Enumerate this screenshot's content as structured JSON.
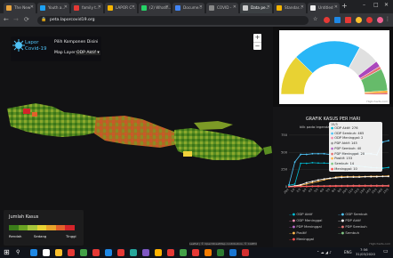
{
  "tabs": [
    {
      "label": "The New",
      "color": "#e8a33d"
    },
    {
      "label": "Youth a...",
      "color": "#1da1f2"
    },
    {
      "label": "family t...",
      "color": "#e53935"
    },
    {
      "label": "LAPOR C...",
      "color": "#f4b400"
    },
    {
      "label": "(2) Whats...",
      "color": "#25d366"
    },
    {
      "label": "Docume...",
      "color": "#4285f4"
    },
    {
      "label": "COVID -",
      "color": "#888888"
    },
    {
      "label": "Data pe...",
      "color": "#cccccc"
    },
    {
      "label": "Standar...",
      "color": "#f4b400"
    },
    {
      "label": "Untitled",
      "color": "#eeeeee"
    }
  ],
  "address": {
    "url": "peta.laporcovid19.org"
  },
  "window": {
    "minimize": "–",
    "maximize": "□",
    "close": "✕",
    "new_tab": "+"
  },
  "app": {
    "logo_line1": "Lapor",
    "logo_line2": "Covid-19",
    "pilih_label": "Pilih Komponen Disini",
    "map_layer_label": "Map Layer",
    "map_layer_value": "ODP Aktif",
    "zoom_in": "+",
    "zoom_out": "−"
  },
  "legend": {
    "title": "Jumlah Kasus",
    "low": "Rendah",
    "mid": "Sedang",
    "high": "Tinggi",
    "colors": [
      "#3b7d1a",
      "#6aa323",
      "#a7c53b",
      "#e8d233",
      "#e8a32a",
      "#e2612a",
      "#d4242a"
    ]
  },
  "map": {
    "credit": "Leaflet | © OpenStreetMap contributors, © CARTO"
  },
  "side": {
    "pie_caption": "Highcharts.com",
    "chart_title": "GRAFIK KASUS PER HARI",
    "chart_subtitle": "klik pada legenda",
    "chart_credit": "Highcharts.com",
    "tooltip": {
      "title": "15/3",
      "lines": [
        {
          "color": "#00bcd4",
          "text": "ODP Aktif: 276"
        },
        {
          "color": "#4fc3f7",
          "text": "ODP Sembuh: 465"
        },
        {
          "color": "#f48fb1",
          "text": "ODP Meninggal: 2"
        },
        {
          "color": "#ffffff",
          "text": "PDP Aktif: 145"
        },
        {
          "color": "#ba68c8",
          "text": "PDP Sembuh: 40"
        },
        {
          "color": "#e57373",
          "text": "PDP Meninggal: 20"
        },
        {
          "color": "#ffb74d",
          "text": "Positif: 153"
        },
        {
          "color": "#81c784",
          "text": "Sembuh: 14"
        },
        {
          "color": "#ff5252",
          "text": "Meninggal: 10"
        }
      ]
    },
    "legend_items": [
      {
        "color": "#00bcd4",
        "text": "ODP Aktif"
      },
      {
        "color": "#4fc3f7",
        "text": "ODP Sembuh"
      },
      {
        "color": "#f48fb1",
        "text": "ODP Meninggal"
      },
      {
        "color": "#ffffff",
        "text": "PDP Aktif"
      },
      {
        "color": "#ba68c8",
        "text": "PDP Meninggal"
      },
      {
        "color": "#e57373",
        "text": "PDP Sembuh"
      },
      {
        "color": "#ffb74d",
        "text": "Positif"
      },
      {
        "color": "#81c784",
        "text": "Sembuh"
      },
      {
        "color": "#ff5252",
        "text": "Meninggal"
      }
    ]
  },
  "chart_data": [
    {
      "type": "pie",
      "values": [
        276,
        465,
        2,
        145,
        40,
        20,
        153,
        14,
        10
      ],
      "colors": [
        "#e8d233",
        "#29b6f6",
        "#ef6c6c",
        "#e0e0e0",
        "#ab47bc",
        "#e57373",
        "#66bb6a",
        "#ff9800",
        "#d32f2f"
      ]
    },
    {
      "type": "line",
      "title": "GRAFIK KASUS PER HARI",
      "ylabel": "",
      "ylim": [
        0,
        800
      ],
      "yticks": [
        "0",
        "250",
        "500",
        "750"
      ],
      "categories": [
        "29/2",
        "1/3",
        "2/3",
        "3/3",
        "4/3",
        "5/3",
        "6/3",
        "7/3",
        "8/3",
        "9/3",
        "10/3",
        "11/3",
        "12/3",
        "13/3",
        "14/3",
        "15/3",
        "16/3",
        "17/3"
      ],
      "series": [
        {
          "color": "#4fc3f7",
          "values": [
            30,
            360,
            470,
            470,
            480,
            480,
            480,
            470,
            480,
            480,
            470,
            480,
            480,
            480,
            480,
            465,
            650,
            670
          ]
        },
        {
          "color": "#00bcd4",
          "values": [
            20,
            40,
            340,
            340,
            350,
            345,
            345,
            340,
            335,
            330,
            320,
            310,
            300,
            290,
            280,
            276,
            270,
            280
          ]
        },
        {
          "color": "#ffb74d",
          "values": [
            5,
            10,
            20,
            40,
            60,
            80,
            100,
            120,
            140,
            150,
            150,
            150,
            150,
            150,
            153,
            153,
            155,
            160
          ]
        },
        {
          "color": "#ffffff",
          "values": [
            5,
            15,
            30,
            60,
            80,
            100,
            115,
            125,
            130,
            135,
            140,
            140,
            140,
            145,
            145,
            145,
            150,
            150
          ]
        },
        {
          "color": "#e57373",
          "values": [
            2,
            5,
            8,
            10,
            12,
            14,
            15,
            16,
            17,
            18,
            19,
            20,
            20,
            20,
            20,
            20,
            20,
            20
          ]
        },
        {
          "color": "#ff5252",
          "values": [
            1,
            2,
            3,
            4,
            5,
            5,
            6,
            7,
            7,
            8,
            8,
            9,
            9,
            10,
            10,
            10,
            10,
            10
          ]
        }
      ]
    }
  ],
  "taskbar": {
    "time": "7:56",
    "date": "31/03/2020",
    "lang": "ENG",
    "icons": [
      "#1e88e5",
      "#ffffff",
      "#fbc02d",
      "#e53935",
      "#43a047",
      "#e53935",
      "#1e88e5",
      "#e53935",
      "#26a69a",
      "#7e57c2",
      "#ffb300",
      "#e53935",
      "#43a047",
      "#e53935",
      "#f57c00",
      "#2e7d32",
      "#1976d2",
      "#d32f2f"
    ]
  }
}
